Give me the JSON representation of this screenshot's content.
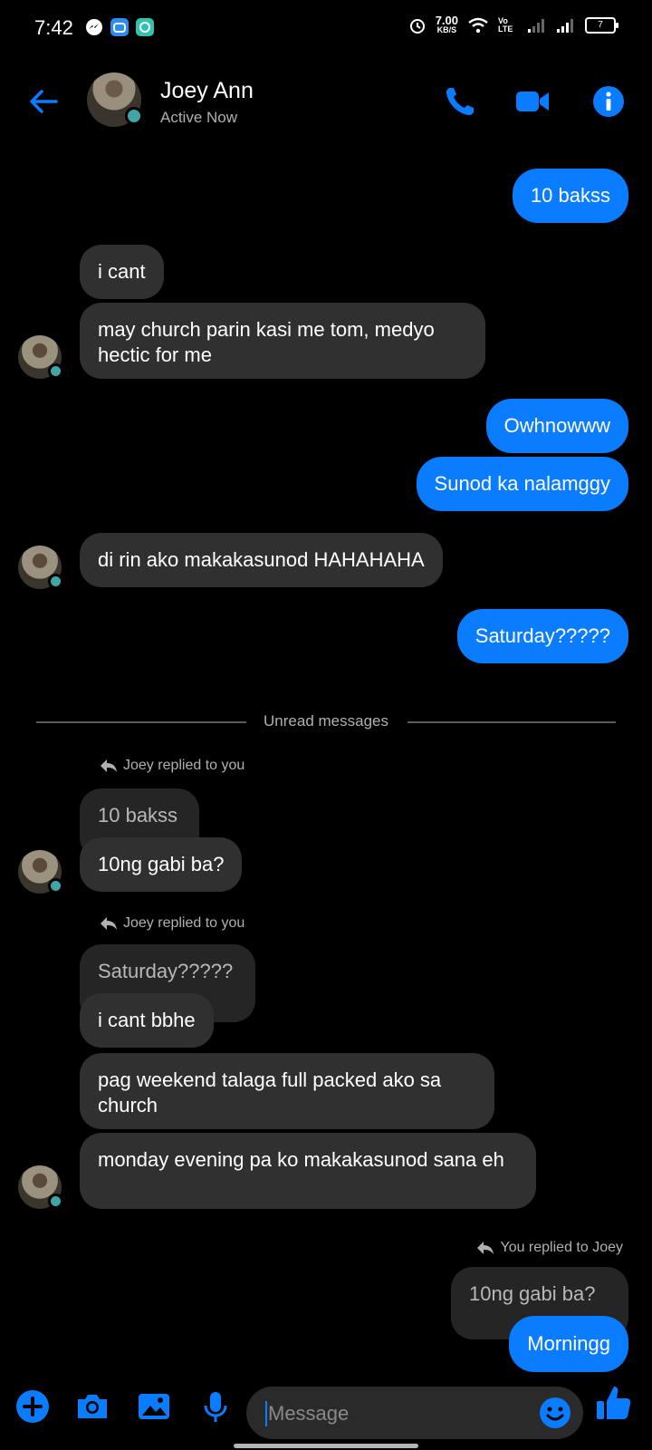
{
  "status_bar": {
    "time": "7:42",
    "net_speed_value": "7.00",
    "net_speed_unit": "KB/S",
    "volte": "Vo LTE",
    "battery": "7"
  },
  "header": {
    "name": "Joey Ann",
    "status": "Active Now"
  },
  "conversation": {
    "out_1": "10 bakss",
    "in_1": "i cant",
    "in_2": "may church parin kasi me tom, medyo hectic for me",
    "out_2": "Owhnowww",
    "out_3": "Sunod ka nalamggy",
    "in_3": "di rin ako makakasunod HAHAHAHA",
    "out_4": "Saturday?????",
    "unread_label": "Unread messages",
    "reply_note_1": "Joey replied to you",
    "quote_1": "10 bakss",
    "in_4": "10ng gabi ba?",
    "reply_note_2": "Joey replied to you",
    "quote_2": "Saturday?????",
    "in_5": "i cant bbhe",
    "in_6": "pag weekend talaga full packed ako sa church",
    "in_7": "monday evening pa ko makakasunod sana eh",
    "reply_note_3": "You replied to Joey",
    "quote_3": "10ng gabi ba?",
    "out_5": "Morningg"
  },
  "composer": {
    "placeholder": "Message"
  },
  "colors": {
    "accent": "#0a7cff",
    "incoming_bubble": "#303030",
    "background": "#000000",
    "presence": "#3fa6a6"
  }
}
